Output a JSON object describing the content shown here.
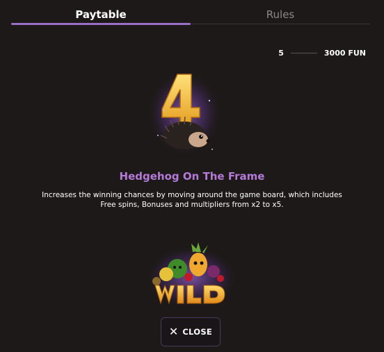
{
  "tabs": {
    "paytable": "Paytable",
    "rules": "Rules"
  },
  "payout": {
    "count": "5",
    "amount": "3000 FUN"
  },
  "symbol": {
    "title": "Hedgehog On The Frame",
    "description": "Increases the winning chances by moving around the game board, which includes Free spins, Bonuses and multipliers from x2 to x5.",
    "icon": "hedgehog-4-icon"
  },
  "next_symbol": {
    "label": "WILD",
    "icon": "wild-fruits-icon"
  },
  "close": {
    "label": "CLOSE",
    "icon": "close-icon"
  },
  "colors": {
    "accent": "#9a6fc8",
    "title": "#b47ad8",
    "background": "#1d1918"
  }
}
